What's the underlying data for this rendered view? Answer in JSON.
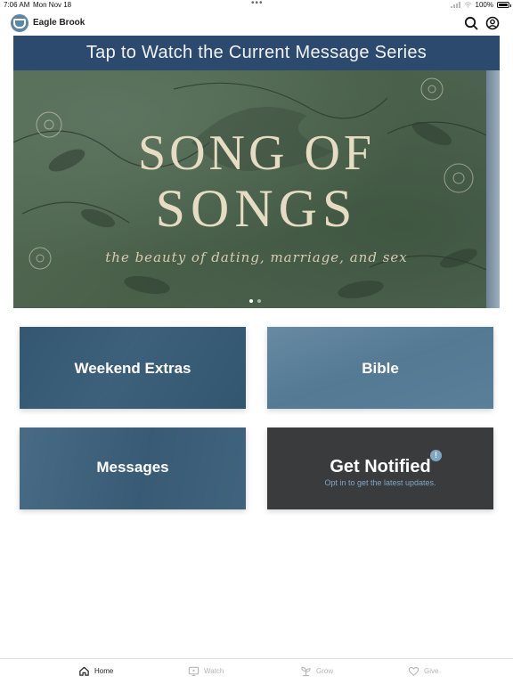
{
  "status_bar": {
    "time": "7:06 AM",
    "date": "Mon Nov 18",
    "battery": "100%"
  },
  "header": {
    "app_title": "Eagle Brook",
    "icons": [
      "search-icon",
      "account-icon"
    ]
  },
  "hero": {
    "banner": "Tap to Watch the Current Message Series",
    "series_title_line1": "SONG OF",
    "series_title_line2": "SONGS",
    "series_subtitle": "the beauty of dating, marriage, and sex",
    "pager": {
      "count": 2,
      "active": 1
    }
  },
  "tiles": [
    {
      "label": "Weekend Extras"
    },
    {
      "label": "Bible"
    },
    {
      "label": "Messages"
    },
    {
      "label": "Get Notified",
      "subtitle": "Opt in to get the latest updates.",
      "badge": "!"
    }
  ],
  "tab_bar": {
    "items": [
      {
        "label": "Home",
        "icon": "home-icon",
        "active": true
      },
      {
        "label": "Watch",
        "icon": "tv-icon",
        "active": false
      },
      {
        "label": "Grow",
        "icon": "sprout-icon",
        "active": false
      },
      {
        "label": "Give",
        "icon": "heart-icon",
        "active": false
      }
    ]
  },
  "colors": {
    "banner": "#2b4a6e",
    "tile_overlay": "#365b76",
    "notified_bg": "#3a3b3d",
    "accent": "#7fa7c4"
  }
}
